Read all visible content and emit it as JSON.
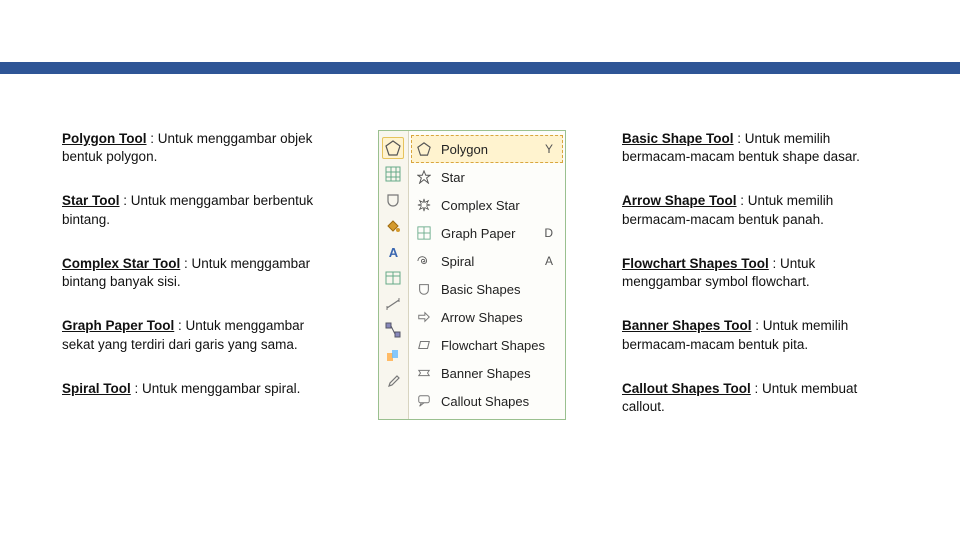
{
  "left": [
    {
      "title": "Polygon Tool",
      "body": " : Untuk menggambar objek bentuk polygon."
    },
    {
      "title": "Star Tool",
      "body": " : Untuk menggambar berbentuk bintang."
    },
    {
      "title": "Complex Star Tool",
      "body": " : Untuk menggambar bintang banyak sisi."
    },
    {
      "title": "Graph Paper Tool",
      "body": " : Untuk menggambar sekat yang terdiri dari garis yang sama."
    },
    {
      "title": "Spiral Tool",
      "body": " : Untuk menggambar spiral."
    }
  ],
  "right": [
    {
      "title": "Basic Shape Tool",
      "body": " : Untuk memilih bermacam-macam bentuk shape dasar."
    },
    {
      "title": "Arrow Shape Tool",
      "body": " : Untuk memilih bermacam-macam bentuk panah."
    },
    {
      "title": "Flowchart Shapes Tool",
      "body": " : Untuk menggambar symbol flowchart."
    },
    {
      "title": "Banner Shapes Tool",
      "body": " : Untuk memilih bermacam-macam bentuk pita."
    },
    {
      "title": "Callout Shapes Tool",
      "body": " : Untuk membuat callout."
    }
  ],
  "flyout": {
    "items": [
      {
        "label": "Polygon",
        "key": "Y",
        "icon": "polygon-icon",
        "selected": true
      },
      {
        "label": "Star",
        "key": "",
        "icon": "star-icon",
        "selected": false
      },
      {
        "label": "Complex Star",
        "key": "",
        "icon": "complex-star-icon",
        "selected": false
      },
      {
        "label": "Graph Paper",
        "key": "D",
        "icon": "graph-paper-icon",
        "selected": false
      },
      {
        "label": "Spiral",
        "key": "A",
        "icon": "spiral-icon",
        "selected": false
      },
      {
        "label": "Basic Shapes",
        "key": "",
        "icon": "basic-shapes-icon",
        "selected": false
      },
      {
        "label": "Arrow Shapes",
        "key": "",
        "icon": "arrow-shapes-icon",
        "selected": false
      },
      {
        "label": "Flowchart Shapes",
        "key": "",
        "icon": "flowchart-shapes-icon",
        "selected": false
      },
      {
        "label": "Banner Shapes",
        "key": "",
        "icon": "banner-shapes-icon",
        "selected": false
      },
      {
        "label": "Callout Shapes",
        "key": "",
        "icon": "callout-shapes-icon",
        "selected": false
      }
    ]
  }
}
